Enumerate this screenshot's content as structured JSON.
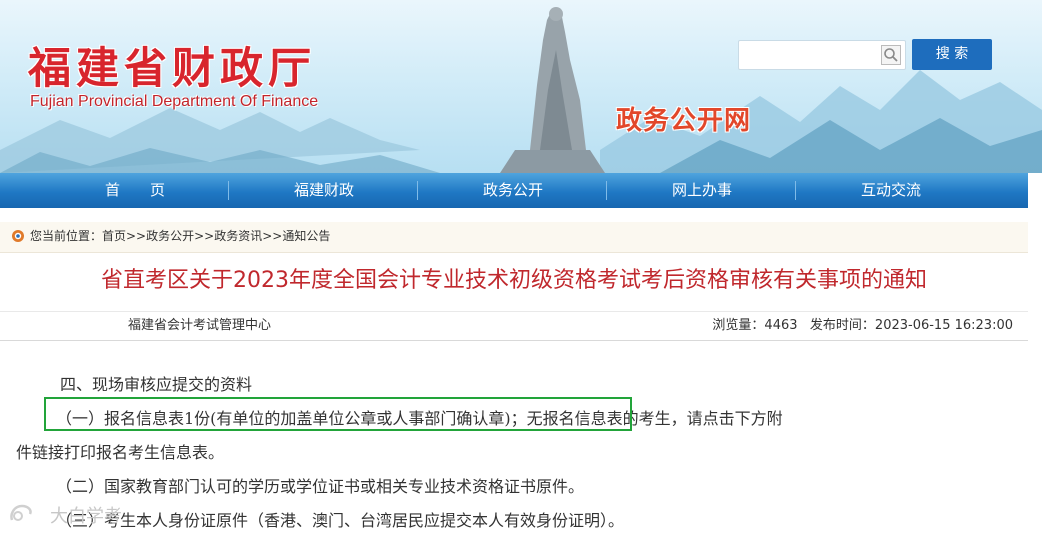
{
  "header": {
    "logo_cn": "福建省财政厅",
    "logo_en": "Fujian Provincial Department Of Finance",
    "subsite": "政务公开网",
    "search": {
      "placeholder": "",
      "button_label": "搜 索"
    }
  },
  "nav": {
    "items": [
      {
        "label": "首　　页"
      },
      {
        "label": "福建财政"
      },
      {
        "label": "政务公开"
      },
      {
        "label": "网上办事"
      },
      {
        "label": "互动交流"
      }
    ]
  },
  "breadcrumb": {
    "text": "您当前位置：首页>>政务公开>>政务资讯>>通知公告"
  },
  "article": {
    "title": "省直考区关于2023年度全国会计专业技术初级资格考试考后资格审核有关事项的通知",
    "source": "福建省会计考试管理中心",
    "views": "浏览量：4463",
    "published": "发布时间：2023-06-15 16:23:00",
    "paragraphs": [
      "四、现场审核应提交的资料",
      "（一）报名信息表1份(有单位的加盖单位公章或人事部门确认章)；无报名信息表的考生，请点击下方附",
      "件链接打印报名考生信息表。",
      "（二）国家教育部门认可的学历或学位证书或相关专业技术资格证书原件。",
      "（三）考生本人身份证原件（香港、澳门、台湾居民应提交本人有效身份证明）。"
    ]
  },
  "watermark": "大白学考",
  "colors": {
    "nav_blue": "#1f78c4",
    "title_red": "#c0282d",
    "logo_red": "#d8252d",
    "highlight_green": "#22a43a",
    "search_button": "#1e6dbd"
  }
}
